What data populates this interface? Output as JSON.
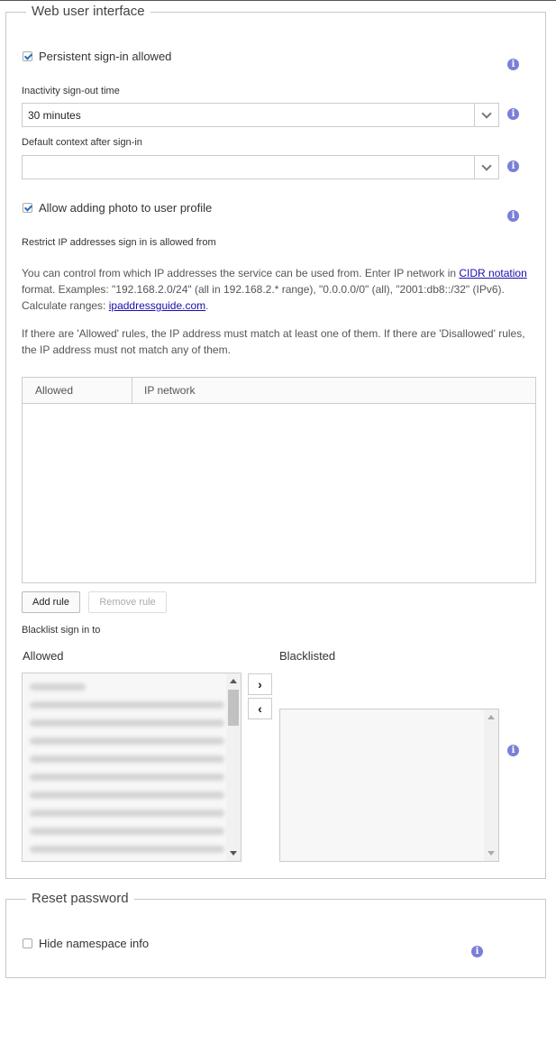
{
  "web_ui": {
    "legend": "Web user interface",
    "persistent_signin_label": "Persistent sign-in allowed",
    "inactivity_label": "Inactivity sign-out time",
    "inactivity_value": "30 minutes",
    "default_context_label": "Default context after sign-in",
    "default_context_value": "",
    "allow_photo_label": "Allow adding photo to user profile",
    "restrict_ip_heading": "Restrict IP addresses sign in is allowed from",
    "para1_part1": "You can control from which IP addresses the service can be used from. Enter IP network in ",
    "para1_link": "CIDR notation",
    "para1_part2": "format. Examples: \"192.168.2.0/24\" (all in 192.168.2.* range), \"0.0.0.0/0\" (all), \"2001:db8::/32\" (IPv6).",
    "para1_part3": "Calculate ranges: ",
    "para1_link2": "ipaddressguide.com",
    "para1_end": ".",
    "para2_line1": "If there are 'Allowed' rules, the IP address must match at least one of them. If there are 'Disallowed' rules,",
    "para2_line2": "the IP address must not match any of them.",
    "table_headers": [
      "Allowed",
      "IP network"
    ],
    "add_rule": "Add rule",
    "remove_rule": "Remove rule",
    "blacklist_heading": "Blacklist sign in to",
    "allowed_label": "Allowed",
    "blacklisted_label": "Blacklisted",
    "move_right": "›",
    "move_left": "‹"
  },
  "reset_password": {
    "legend": "Reset password",
    "hide_namespace_label": "Hide namespace info"
  },
  "icons": {
    "info": "i"
  },
  "colors": {
    "info_icon": "#7b7fd6",
    "link": "#1a0dab",
    "check": "#2a6ebb"
  }
}
